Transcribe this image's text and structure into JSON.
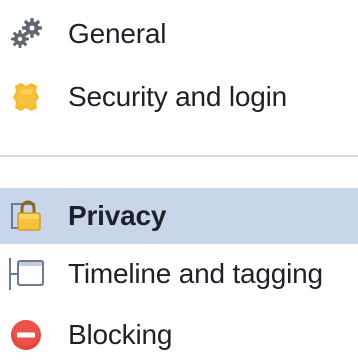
{
  "menu": {
    "items": [
      {
        "label": "General",
        "icon": "gears-icon"
      },
      {
        "label": "Security and login",
        "icon": "shield-badge-icon"
      },
      {
        "label": "Privacy",
        "icon": "lock-icon",
        "selected": true
      },
      {
        "label": "Timeline and tagging",
        "icon": "timeline-icon"
      },
      {
        "label": "Blocking",
        "icon": "blocking-icon"
      }
    ]
  },
  "colors": {
    "selected_bg": "#c9d5e8",
    "text": "#1d2129",
    "divider": "#d7d9dd",
    "gear": "#606770",
    "shield": "#f7b928",
    "lock": "#f5c33b",
    "blocking": "#e9453d",
    "timeline": "#6b7a99"
  }
}
